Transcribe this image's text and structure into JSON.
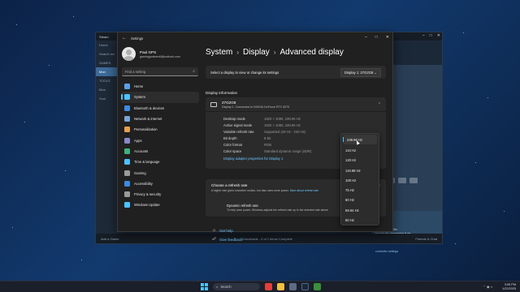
{
  "steam": {
    "title": "Steam",
    "side_items": [
      "Home",
      "Search rec",
      "GAMES",
      "Mon",
      "TOOLS",
      "Bloo",
      "Soul"
    ],
    "right_texts": [
      "ble With Your",
      "to your controller,",
      "tomatically remapping it via",
      "may not be correct",
      "controller settings"
    ],
    "add_game": "Add a Game",
    "downloads": "Downloads - 0 of 1 items Complete",
    "friends": "Friends & Chat"
  },
  "settings": {
    "title": "Settings",
    "profile": {
      "name": "Paul GPS",
      "email": "gamingpcsbemill@outlook.com"
    },
    "search_placeholder": "Find a setting",
    "nav": [
      {
        "label": "Home",
        "color": "#5aa0e6"
      },
      {
        "label": "System",
        "color": "#4cc2ff"
      },
      {
        "label": "Bluetooth & devices",
        "color": "#3d8be0"
      },
      {
        "label": "Network & internet",
        "color": "#7aa6d8"
      },
      {
        "label": "Personalization",
        "color": "#e8a050"
      },
      {
        "label": "Apps",
        "color": "#8888cc"
      },
      {
        "label": "Accounts",
        "color": "#3fb27f"
      },
      {
        "label": "Time & language",
        "color": "#4cc2ff"
      },
      {
        "label": "Gaming",
        "color": "#9a9a9a"
      },
      {
        "label": "Accessibility",
        "color": "#3d8be0"
      },
      {
        "label": "Privacy & security",
        "color": "#9a9a9a"
      },
      {
        "label": "Windows Update",
        "color": "#4cc2ff"
      }
    ],
    "breadcrumb": [
      "System",
      "Display",
      "Advanced display"
    ],
    "select_display_label": "Select a display to view or change its settings",
    "select_display_value": "Display 1: 27G2G8",
    "display_info_title": "Display information",
    "monitor": {
      "name": "27G2G8",
      "sub": "Display 1: Connected to NVIDIA GeForce RTX 3070"
    },
    "info_rows": [
      {
        "k": "Desktop mode",
        "v": "1920 × 1080, 239.96 Hz"
      },
      {
        "k": "Active signal mode",
        "v": "1920 × 1080, 239.96 Hz"
      },
      {
        "k": "Variable refresh rate",
        "v": "Supported (49 Hz - 240 Hz)"
      },
      {
        "k": "Bit depth",
        "v": "8-bit"
      },
      {
        "k": "Color format",
        "v": "RGB"
      },
      {
        "k": "Color space",
        "v": "Standard dynamic range (SDR)"
      }
    ],
    "adapter_link": "Display adapter properties for Display 1",
    "refresh": {
      "title": "Choose a refresh rate",
      "sub": "A higher rate gives smoother motion, but also uses more power.",
      "more_link": "More about refresh rate",
      "dynamic_title": "Dynamic refresh rate",
      "dynamic_sub": "To help save power, Windows adjusts the refresh rate up to the selected rate above"
    },
    "get_help": "Get help",
    "give_feedback": "Give feedback"
  },
  "refresh_options": [
    "239.96 Hz",
    "144 Hz",
    "120 Hz",
    "119.88 Hz",
    "100 Hz",
    "75 Hz",
    "60 Hz",
    "59.94 Hz",
    "50 Hz"
  ],
  "refresh_selected_index": 0,
  "taskbar": {
    "search": "Search",
    "time": "3:55 PM",
    "date": "1/22/2025"
  }
}
